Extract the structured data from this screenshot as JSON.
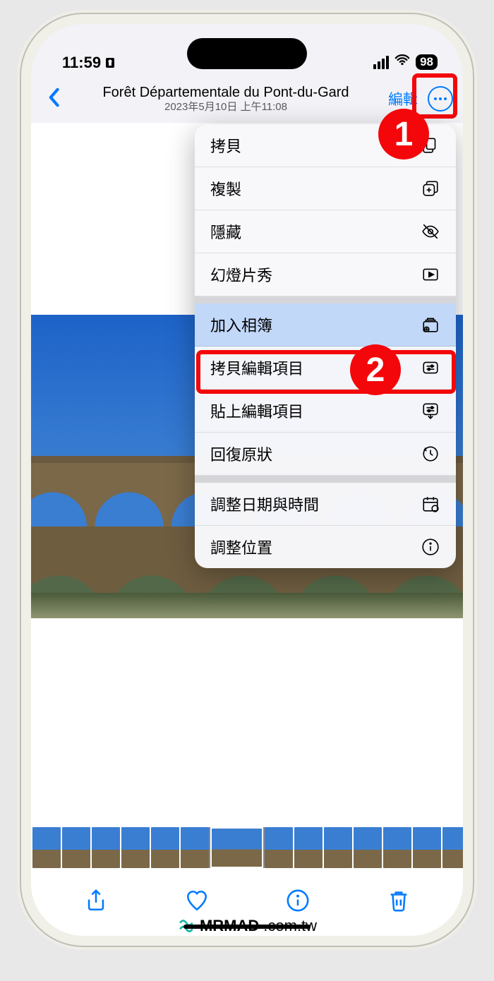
{
  "status": {
    "time": "11:59",
    "battery": "98"
  },
  "nav": {
    "title": "Forêt Départementale du Pont-du-Gard",
    "subtitle": "2023年5月10日 上午11:08",
    "edit": "編輯"
  },
  "callouts": {
    "badge1": "1",
    "badge2": "2"
  },
  "menu": {
    "group1": [
      {
        "label": "拷貝",
        "icon": "copy-doc"
      },
      {
        "label": "複製",
        "icon": "duplicate"
      },
      {
        "label": "隱藏",
        "icon": "eye-slash"
      },
      {
        "label": "幻燈片秀",
        "icon": "play-rect"
      }
    ],
    "group2": [
      {
        "label": "加入相簿",
        "icon": "album-add",
        "selected": true
      },
      {
        "label": "拷貝編輯項目",
        "icon": "sliders-copy"
      },
      {
        "label": "貼上編輯項目",
        "icon": "sliders-paste"
      },
      {
        "label": "回復原狀",
        "icon": "reset"
      }
    ],
    "group3": [
      {
        "label": "調整日期與時間",
        "icon": "calendar"
      },
      {
        "label": "調整位置",
        "icon": "info"
      }
    ]
  },
  "watermark": {
    "brand": "MRMAD",
    "domain": ".com.tw"
  }
}
